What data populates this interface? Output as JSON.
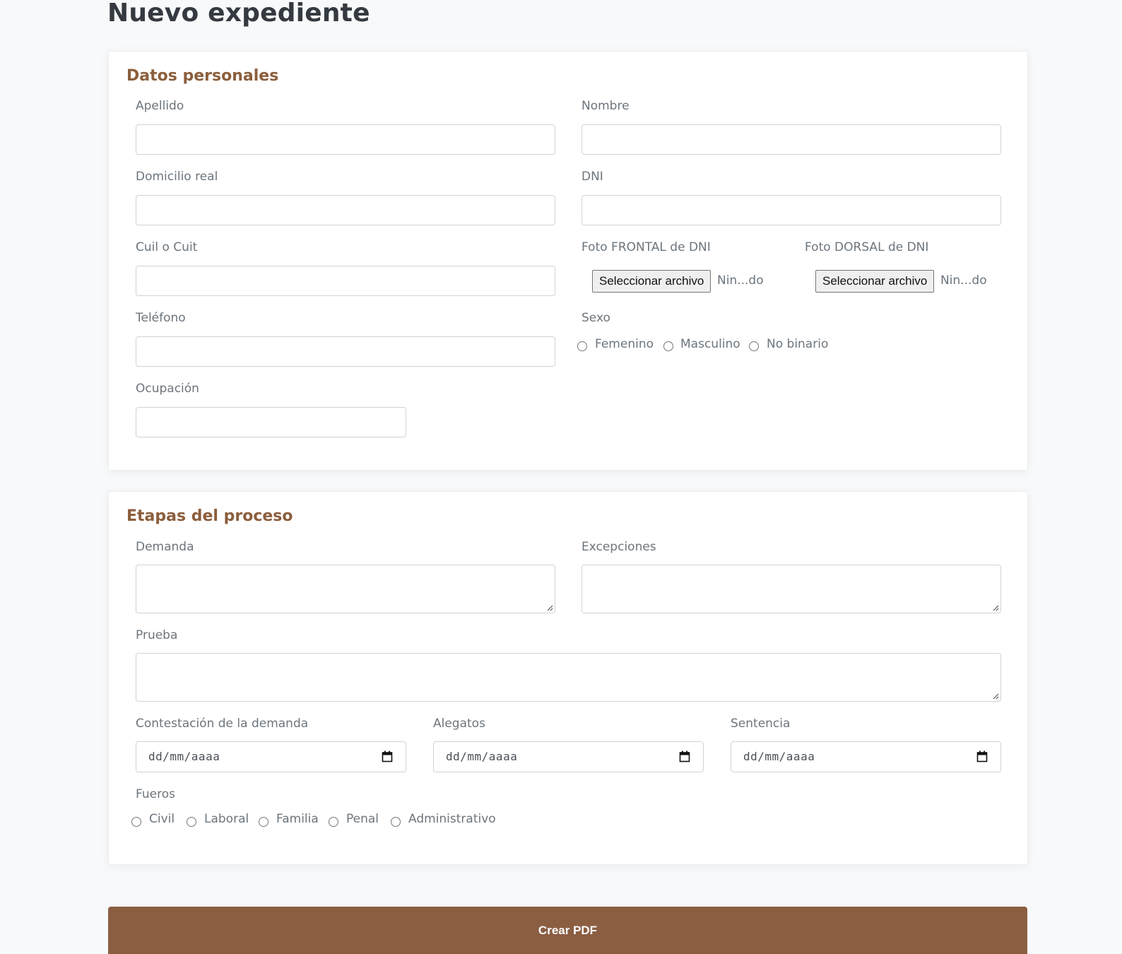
{
  "page": {
    "title": "Nuevo expediente"
  },
  "personal": {
    "title": "Datos personales",
    "apellido": {
      "label": "Apellido",
      "value": ""
    },
    "nombre": {
      "label": "Nombre",
      "value": ""
    },
    "domicilio": {
      "label": "Domicilio real",
      "value": ""
    },
    "dni": {
      "label": "DNI",
      "value": ""
    },
    "cuil": {
      "label": "Cuil o Cuit",
      "value": ""
    },
    "foto_frontal": {
      "label": "Foto FRONTAL de DNI",
      "button": "Seleccionar archivo",
      "status": "Nin...do"
    },
    "foto_dorsal": {
      "label": "Foto DORSAL de DNI",
      "button": "Seleccionar archivo",
      "status": "Nin...do"
    },
    "telefono": {
      "label": "Teléfono",
      "value": ""
    },
    "sexo": {
      "label": "Sexo",
      "options": [
        "Femenino",
        "Masculino",
        "No binario"
      ]
    },
    "ocupacion": {
      "label": "Ocupación",
      "value": ""
    }
  },
  "process": {
    "title": "Etapas del proceso",
    "demanda": {
      "label": "Demanda"
    },
    "excepciones": {
      "label": "Excepciones"
    },
    "prueba": {
      "label": "Prueba"
    },
    "contestacion": {
      "label": "Contestación de la demanda",
      "placeholder": "dd/mm/aaaa"
    },
    "alegatos": {
      "label": "Alegatos",
      "placeholder": "dd/mm/aaaa"
    },
    "sentencia": {
      "label": "Sentencia",
      "placeholder": "dd/mm/aaaa"
    },
    "fueros": {
      "label": "Fueros",
      "options": [
        "Civil",
        "Laboral",
        "Familia",
        "Penal",
        "Administrativo"
      ]
    }
  },
  "submit": {
    "label": "Crear PDF"
  },
  "colors": {
    "accent": "#8b5e42",
    "heading": "#8b5e3c",
    "title": "#343a40"
  },
  "icons": {
    "date": "calendar-icon",
    "resize": "resize-grip-icon"
  }
}
